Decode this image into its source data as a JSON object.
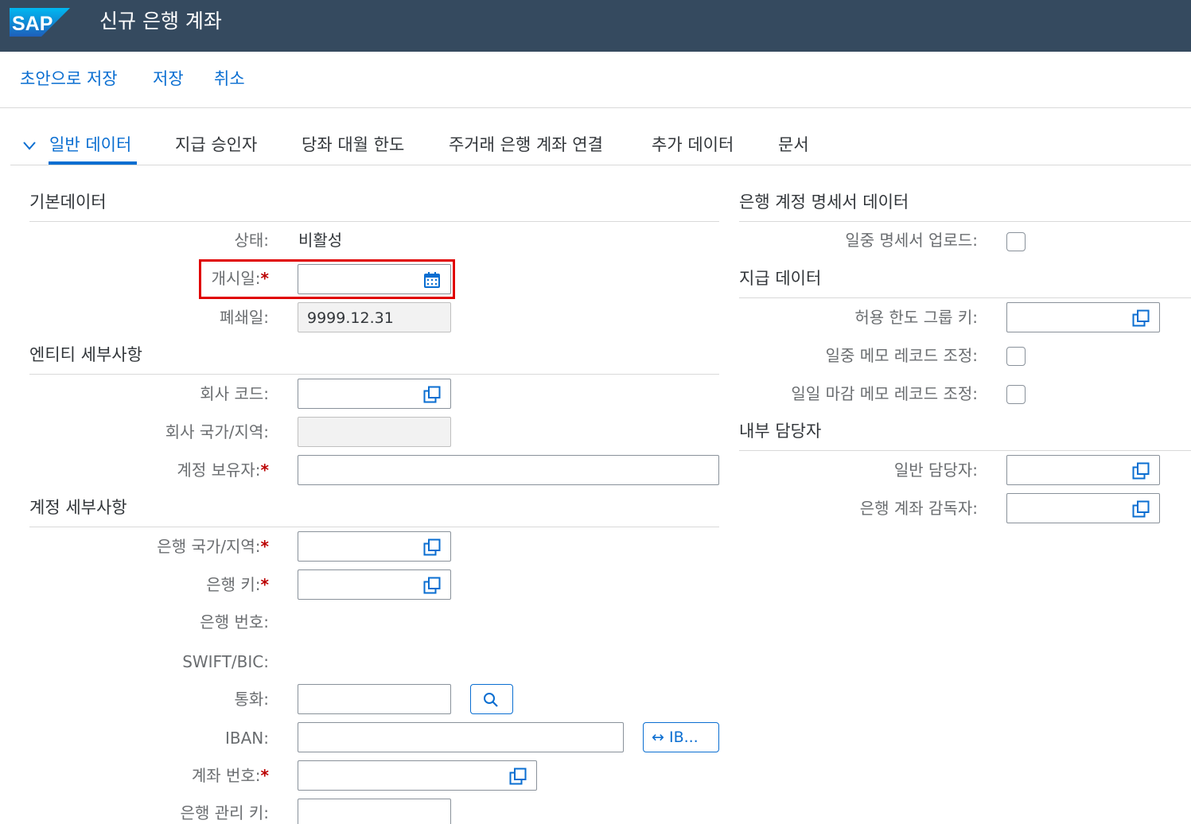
{
  "shell": {
    "logo_text": "SAP",
    "title": "신규 은행 계좌"
  },
  "toolbar": {
    "save_draft": "초안으로 저장",
    "save": "저장",
    "cancel": "취소"
  },
  "tabs": [
    {
      "label": "일반 데이터",
      "active": true
    },
    {
      "label": "지급 승인자"
    },
    {
      "label": "당좌 대월 한도"
    },
    {
      "label": "주거래 은행 계좌 연결"
    },
    {
      "label": "추가 데이터"
    },
    {
      "label": "문서"
    }
  ],
  "basic": {
    "title": "기본데이터",
    "status_label": "상태:",
    "status_value": "비활성",
    "open_date_label": "개시일:",
    "close_date_label": "폐쇄일:",
    "close_date_value": "9999.12.31"
  },
  "entity": {
    "title": "엔티티 세부사항",
    "company_code_label": "회사 코드:",
    "company_country_label": "회사 국가/지역:",
    "account_holder_label": "계정 보유자:"
  },
  "account": {
    "title": "계정 세부사항",
    "bank_country_label": "은행 국가/지역:",
    "bank_key_label": "은행 키:",
    "bank_number_label": "은행 번호:",
    "swift_label": "SWIFT/BIC:",
    "currency_label": "통화:",
    "iban_label": "IBAN:",
    "iban_button": "↔ IB...",
    "account_number_label": "계좌 번호:",
    "bank_control_key_label": "은행 관리 키:"
  },
  "statement": {
    "title": "은행 계정 명세서 데이터",
    "intraday_upload_label": "일중 명세서 업로드:"
  },
  "payment": {
    "title": "지급 데이터",
    "tolerance_group_label": "허용 한도 그룹 키:",
    "intraday_memo_label": "일중 메모 레코드 조정:",
    "daily_memo_label": "일일 마감 메모 레코드 조정:"
  },
  "internal": {
    "title": "내부 담당자",
    "general_contact_label": "일반 담당자:",
    "supervisor_label": "은행 계좌 감독자:"
  },
  "required_marker": "*",
  "colors": {
    "shell": "#354a5f",
    "accent": "#0a6ed1",
    "required": "#bb0000",
    "highlight": "#e00000"
  }
}
